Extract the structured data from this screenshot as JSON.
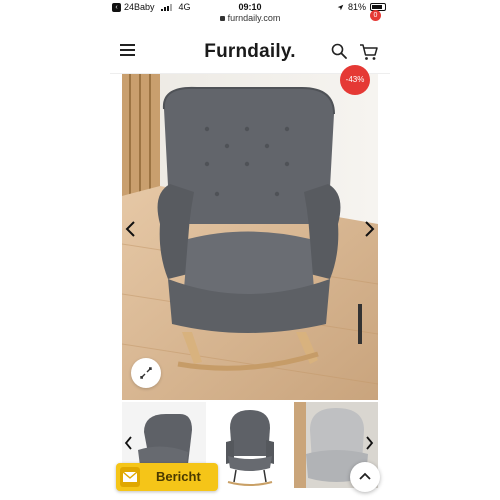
{
  "status_bar": {
    "carrier": "24Baby",
    "network": "4G",
    "time": "09:10",
    "battery": "81%"
  },
  "url_bar": {
    "url": "furndaily.com"
  },
  "header": {
    "brand": "Furndaily.",
    "cart_count": "0"
  },
  "product": {
    "discount_badge": "-43%"
  },
  "message_button": {
    "label": "Bericht"
  },
  "colors": {
    "accent_red": "#e53935",
    "message_yellow": "#f5c518",
    "chair_gray": "#62656b",
    "floor_wood": "#d9b896"
  },
  "icons": [
    "menu-icon",
    "search-icon",
    "cart-icon",
    "chevron-left-icon",
    "chevron-right-icon",
    "expand-icon",
    "envelope-icon",
    "chevron-up-icon"
  ]
}
